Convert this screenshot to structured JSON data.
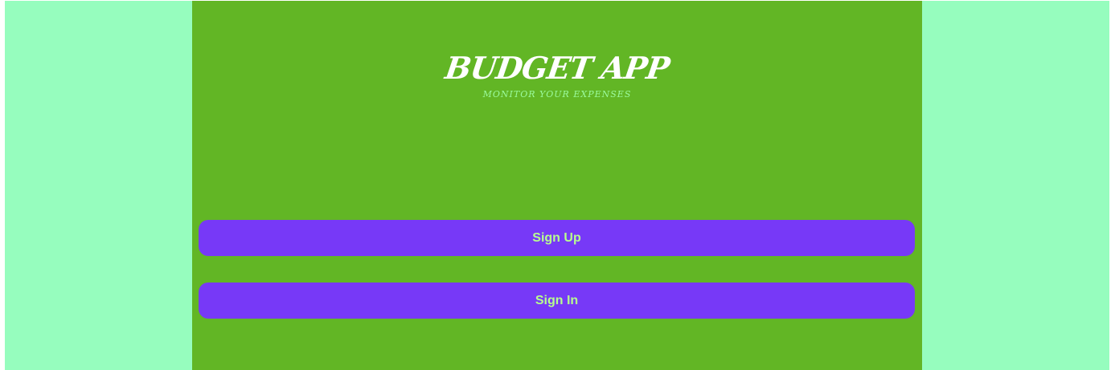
{
  "brand": {
    "title": "BUDGET APP",
    "subtitle": "MONITOR YOUR EXPENSES"
  },
  "actions": {
    "sign_up_label": "Sign Up",
    "sign_in_label": "Sign In"
  },
  "colors": {
    "outer_background": "#96fdbe",
    "panel_background": "#62b625",
    "button_background": "#7739f7",
    "button_text": "#b7ff8e",
    "title_text": "#ffffff",
    "subtitle_text": "#9bfb9e"
  }
}
